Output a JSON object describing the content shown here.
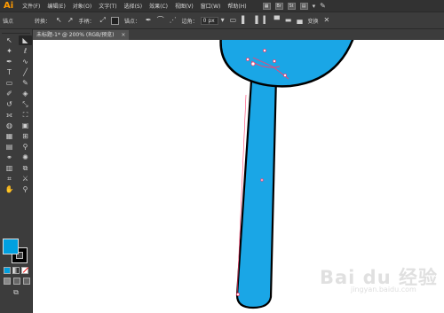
{
  "app": {
    "logo": "Ai"
  },
  "menubar": {
    "items": [
      "文件(F)",
      "编辑(E)",
      "对象(O)",
      "文字(T)",
      "选择(S)",
      "效果(C)",
      "视图(V)",
      "窗口(W)",
      "帮助(H)"
    ],
    "right_labels": [
      "Br",
      "St"
    ]
  },
  "controlbar": {
    "anchor_label": "锚点",
    "convert_label": "转换：",
    "handle_label": "手柄：",
    "anchor2_label": "锚点：",
    "corner_label": "边角：",
    "corner_value": "0 px",
    "transform_label": "变换"
  },
  "document": {
    "tab_title": "未标题-1* @ 200% (RGB/预览)",
    "tab_close": "×"
  },
  "colors": {
    "fill": "#00a0e0",
    "stroke": "#000000",
    "shape_fill": "#1aa6e6",
    "shape_stroke": "#000000",
    "anchor_color": "#ff3d6e"
  },
  "watermark": {
    "main": "Bai du 经验",
    "sub": "jingyan.baidu.com"
  }
}
